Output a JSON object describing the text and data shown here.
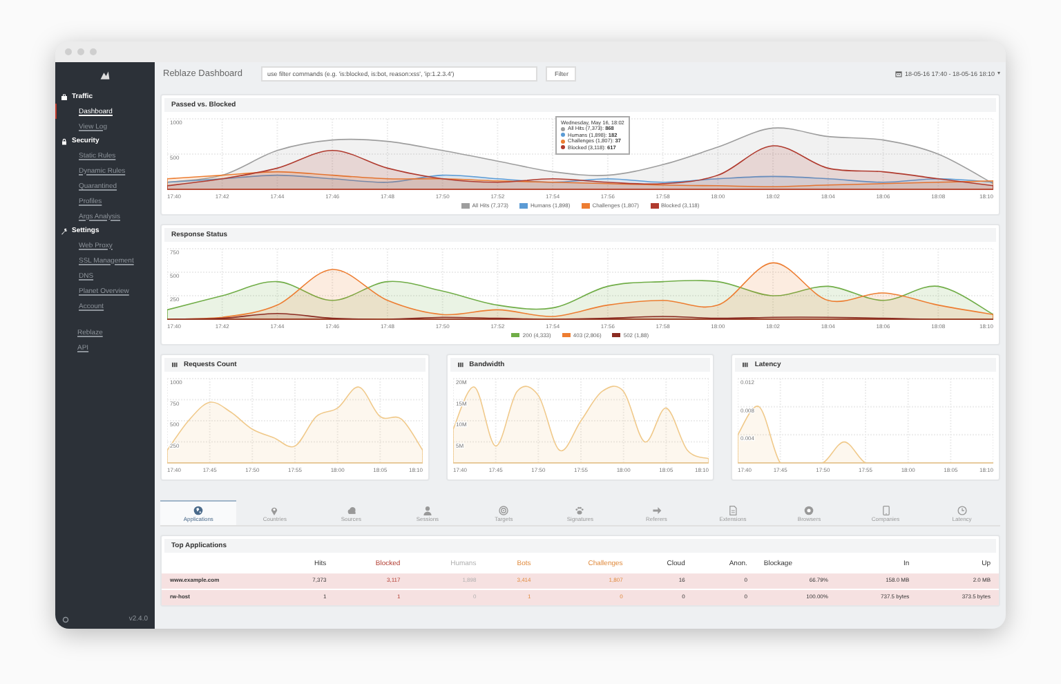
{
  "sidebar": {
    "groups": [
      {
        "label": "Traffic",
        "items": [
          {
            "label": "Dashboard",
            "selected": true
          },
          {
            "label": "View Log",
            "selected": false
          }
        ]
      },
      {
        "label": "Security",
        "items": [
          {
            "label": "Static Rules",
            "selected": false
          },
          {
            "label": "Dynamic Rules",
            "selected": false
          },
          {
            "label": "Quarantined",
            "selected": false
          },
          {
            "label": "Profiles",
            "selected": false
          },
          {
            "label": "Args Analysis",
            "selected": false
          }
        ]
      },
      {
        "label": "Settings",
        "items": [
          {
            "label": "Web Proxy",
            "selected": false
          },
          {
            "label": "SSL Management",
            "selected": false
          },
          {
            "label": "DNS",
            "selected": false
          },
          {
            "label": "Planet Overview",
            "selected": false
          },
          {
            "label": "Account",
            "selected": false
          }
        ]
      }
    ],
    "links": [
      "Reblaze",
      "API"
    ],
    "version": "v2.4.0"
  },
  "header": {
    "title": "Reblaze Dashboard",
    "filter": {
      "placeholder": "use filter commands (e.g. 'is:blocked, is:bot, reason:xss', 'ip:1.2.3.4')",
      "button": "Filter"
    },
    "date_range": "18-05-16 17:40 - 18-05-16 18:10"
  },
  "panels": [
    {
      "title": "Passed vs. Blocked",
      "chart_data": {
        "type": "area",
        "grid": true,
        "legend": "bottom",
        "categories": [
          "17:40",
          "17:42",
          "17:44",
          "17:46",
          "17:48",
          "17:50",
          "17:52",
          "17:54",
          "17:56",
          "17:58",
          "18:00",
          "18:02",
          "18:04",
          "18:06",
          "18:08",
          "18:10"
        ],
        "ylim": [
          0,
          1000
        ],
        "yticks": [
          500,
          1000
        ],
        "series": [
          {
            "name": "All Hits (7,373)",
            "color": "#9e9e9e",
            "values": [
              100,
              200,
              550,
              700,
              680,
              550,
              400,
              250,
              200,
              350,
              600,
              868,
              750,
              700,
              500,
              80
            ]
          },
          {
            "name": "Humans (1,898)",
            "color": "#5b9bd5",
            "values": [
              100,
              150,
              200,
              150,
              100,
              200,
              150,
              100,
              150,
              100,
              150,
              182,
              150,
              100,
              150,
              100
            ]
          },
          {
            "name": "Challenges (1,807)",
            "color": "#ed7d31",
            "values": [
              150,
              200,
              250,
              200,
              150,
              150,
              120,
              100,
              80,
              60,
              50,
              37,
              60,
              80,
              100,
              120
            ]
          },
          {
            "name": "Blocked (3,118)",
            "color": "#b03a2e",
            "values": [
              50,
              150,
              300,
              550,
              300,
              150,
              100,
              150,
              100,
              80,
              200,
              617,
              300,
              250,
              150,
              50
            ]
          }
        ]
      },
      "tooltip": {
        "title": "Wednesday, May 16, 18:02",
        "lines": [
          {
            "text": "All Hits (7,373): **868**",
            "color": "#9e9e9e"
          },
          {
            "text": "Humans (1,898): **182**",
            "color": "#5b9bd5"
          },
          {
            "text": "Challenges (1,807): **37**",
            "color": "#ed7d31"
          },
          {
            "text": "Blocked (3,118): **617**",
            "color": "#b03a2e"
          }
        ]
      }
    },
    {
      "title": "Response Status",
      "chart_data": {
        "type": "area",
        "grid": true,
        "legend": "bottom",
        "categories": [
          "17:40",
          "17:42",
          "17:44",
          "17:46",
          "17:48",
          "17:50",
          "17:52",
          "17:54",
          "17:56",
          "17:58",
          "18:00",
          "18:02",
          "18:04",
          "18:06",
          "18:08",
          "18:10"
        ],
        "ylim": [
          0,
          750
        ],
        "yticks": [
          250,
          500,
          750
        ],
        "series": [
          {
            "name": "200 (4,333)",
            "color": "#70ad47",
            "values": [
              100,
              250,
              400,
              200,
              400,
              300,
              150,
              120,
              350,
              400,
              400,
              250,
              350,
              200,
              350,
              50
            ]
          },
          {
            "name": "403 (2,806)",
            "color": "#ed7d31",
            "values": [
              0,
              20,
              150,
              530,
              200,
              50,
              100,
              30,
              150,
              200,
              150,
              600,
              200,
              280,
              150,
              50
            ]
          },
          {
            "name": "502 (1,88)",
            "color": "#8b2c22",
            "values": [
              0,
              10,
              60,
              10,
              0,
              20,
              10,
              0,
              10,
              30,
              10,
              20,
              20,
              10,
              0,
              0
            ]
          }
        ]
      }
    }
  ],
  "mini_panels": [
    {
      "title": "Requests Count",
      "chart_data": {
        "type": "area",
        "grid": true,
        "categories": [
          "17:40",
          null,
          "17:45",
          null,
          "17:50",
          null,
          "17:55",
          null,
          "18:00",
          null,
          "18:05",
          null,
          "18:10"
        ],
        "ylim": [
          0,
          1000
        ],
        "yticks": [
          250,
          500,
          750,
          1000
        ],
        "series": [
          {
            "color": "#f0c98a",
            "values": [
              150,
              500,
              720,
              600,
              400,
              300,
              200,
              550,
              650,
              900,
              550,
              520,
              150
            ]
          }
        ]
      }
    },
    {
      "title": "Bandwidth",
      "chart_data": {
        "type": "area",
        "grid": true,
        "categories": [
          "17:40",
          null,
          "17:45",
          null,
          "17:50",
          null,
          "17:55",
          null,
          "18:00",
          null,
          "18:05",
          null,
          "18:10"
        ],
        "ylim": [
          0,
          20
        ],
        "yticks": [
          {
            "value": 5,
            "label": "5M"
          },
          {
            "value": 10,
            "label": "10M"
          },
          {
            "value": 15,
            "label": "15M"
          },
          {
            "value": 20,
            "label": "20M"
          }
        ],
        "series": [
          {
            "color": "#f0c98a",
            "values": [
              8,
              18,
              4,
              17,
              16,
              3,
              10,
              17,
              17,
              5,
              13,
              3,
              1
            ]
          }
        ]
      }
    },
    {
      "title": "Latency",
      "chart_data": {
        "type": "area",
        "grid": true,
        "categories": [
          "17:40",
          null,
          "17:45",
          null,
          "17:50",
          null,
          "17:55",
          null,
          "18:00",
          null,
          "18:05",
          null,
          "18:10"
        ],
        "ylim": [
          0,
          0.012
        ],
        "yticks": [
          {
            "value": 0.004,
            "label": "0.004"
          },
          {
            "value": 0.008,
            "label": "0.008"
          },
          {
            "value": 0.012,
            "label": "0.012"
          }
        ],
        "series": [
          {
            "color": "#f0c98a",
            "values": [
              0.004,
              0.008,
              0,
              0,
              0,
              0.003,
              0,
              0,
              0,
              0,
              0,
              0,
              0
            ]
          }
        ]
      }
    }
  ],
  "tabs": [
    {
      "label": "Applications",
      "selected": true
    },
    {
      "label": "Countries",
      "selected": false
    },
    {
      "label": "Sources",
      "selected": false
    },
    {
      "label": "Sessions",
      "selected": false
    },
    {
      "label": "Targets",
      "selected": false
    },
    {
      "label": "Signatures",
      "selected": false
    },
    {
      "label": "Referers",
      "selected": false
    },
    {
      "label": "Extensions",
      "selected": false
    },
    {
      "label": "Browsers",
      "selected": false
    },
    {
      "label": "Companies",
      "selected": false
    },
    {
      "label": "Latency",
      "selected": false
    }
  ],
  "table": {
    "title": "Top Applications",
    "columns": [
      {
        "label": "Hits",
        "kind": "normal"
      },
      {
        "label": "Blocked",
        "kind": "danger"
      },
      {
        "label": "Humans",
        "kind": "muted"
      },
      {
        "label": "Bots",
        "kind": "warning"
      },
      {
        "label": "Challenges",
        "kind": "warning"
      },
      {
        "label": "Cloud",
        "kind": "normal"
      },
      {
        "label": "Anon.",
        "kind": "normal"
      },
      {
        "label": "Blockage",
        "kind": "normal"
      },
      {
        "label": "In",
        "kind": "normal"
      },
      {
        "label": "Up",
        "kind": "normal"
      }
    ],
    "rows": [
      {
        "name": "www.example.com",
        "cells": [
          "7,373",
          "3,117",
          "1,898",
          "3,414",
          "1,807",
          "16",
          "0",
          "66.79%",
          "158.0 MB",
          "2.0 MB"
        ]
      },
      {
        "name": "rw-host",
        "cells": [
          "1",
          "1",
          "0",
          "1",
          "0",
          "0",
          "0",
          "100.00%",
          "737.5 bytes",
          "373.5 bytes"
        ]
      }
    ]
  }
}
